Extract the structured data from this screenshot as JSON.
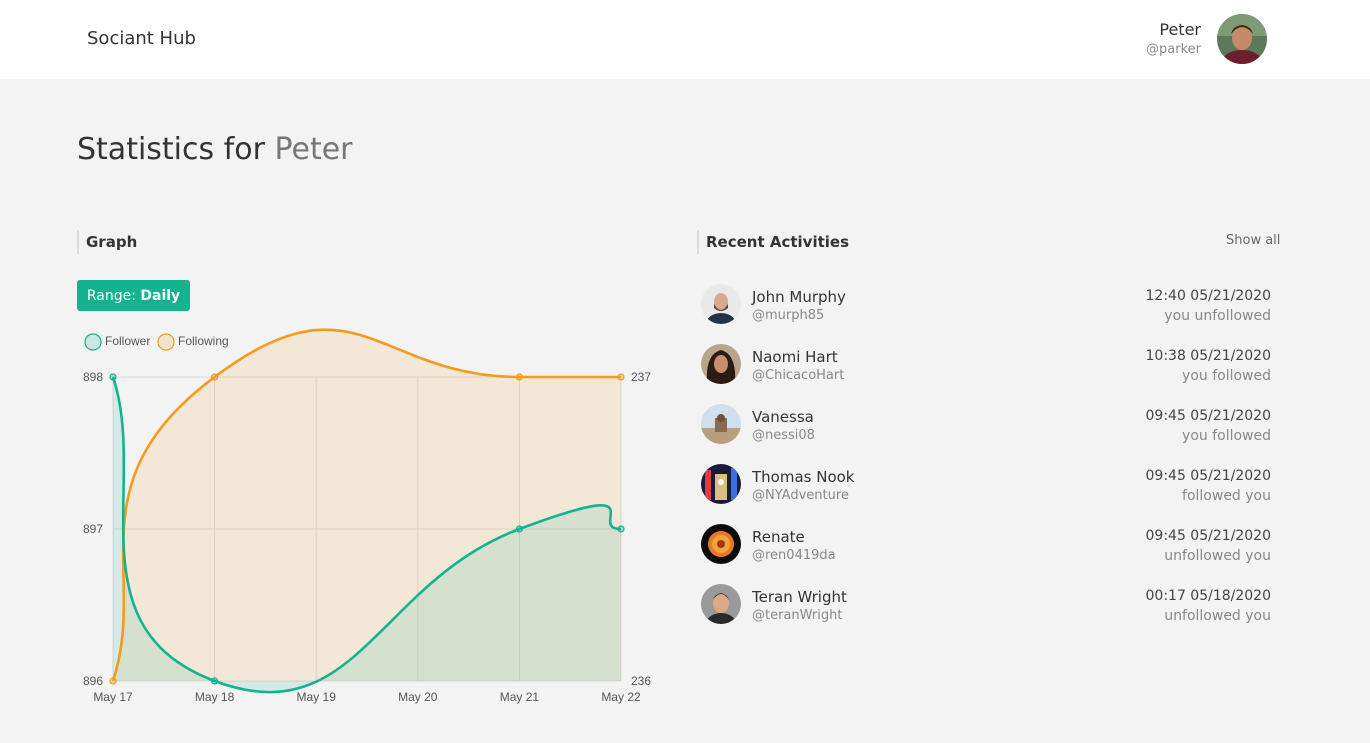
{
  "app": {
    "brand": "Sociant Hub"
  },
  "user": {
    "name": "Peter",
    "handle": "@parker"
  },
  "page": {
    "title_prefix": "Statistics for",
    "title_name": "Peter"
  },
  "graph": {
    "heading": "Graph",
    "range_label": "Range:",
    "range_value": "Daily",
    "legend": [
      "Follower",
      "Following"
    ]
  },
  "chart_data": {
    "type": "line",
    "categories": [
      "May 17",
      "May 18",
      "May 19",
      "May 20",
      "May 21",
      "May 22"
    ],
    "series": [
      {
        "name": "Follower",
        "x": [
          "May 17",
          "May 18",
          "May 21",
          "May 22"
        ],
        "values": [
          898,
          896,
          897,
          897
        ],
        "axis": "left",
        "color": "#13b38f"
      },
      {
        "name": "Following",
        "x": [
          "May 17",
          "May 18",
          "May 21",
          "May 22"
        ],
        "values": [
          236,
          237,
          237,
          237
        ],
        "axis": "right",
        "color": "#f49a1e"
      }
    ],
    "y_left": {
      "ylim": [
        896,
        898
      ],
      "ticks": [
        "898",
        "897",
        "896"
      ]
    },
    "y_right": {
      "ylim": [
        236,
        237
      ],
      "ticks": [
        "237",
        "236"
      ]
    },
    "grid": true,
    "legend_position": "top-left"
  },
  "activities": {
    "heading": "Recent Activities",
    "show_all": "Show all",
    "items": [
      {
        "name": "John Murphy",
        "handle": "@murph85",
        "time": "12:40 05/21/2020",
        "action": "you unfollowed"
      },
      {
        "name": "Naomi Hart",
        "handle": "@ChicacoHart",
        "time": "10:38 05/21/2020",
        "action": "you followed"
      },
      {
        "name": "Vanessa",
        "handle": "@nessi08",
        "time": "09:45 05/21/2020",
        "action": "you followed"
      },
      {
        "name": "Thomas Nook",
        "handle": "@NYAdventure",
        "time": "09:45 05/21/2020",
        "action": "followed you"
      },
      {
        "name": "Renate",
        "handle": "@ren0419da",
        "time": "09:45 05/21/2020",
        "action": "unfollowed you"
      },
      {
        "name": "Teran Wright",
        "handle": "@teranWright",
        "time": "00:17 05/18/2020",
        "action": "unfollowed you"
      }
    ]
  }
}
